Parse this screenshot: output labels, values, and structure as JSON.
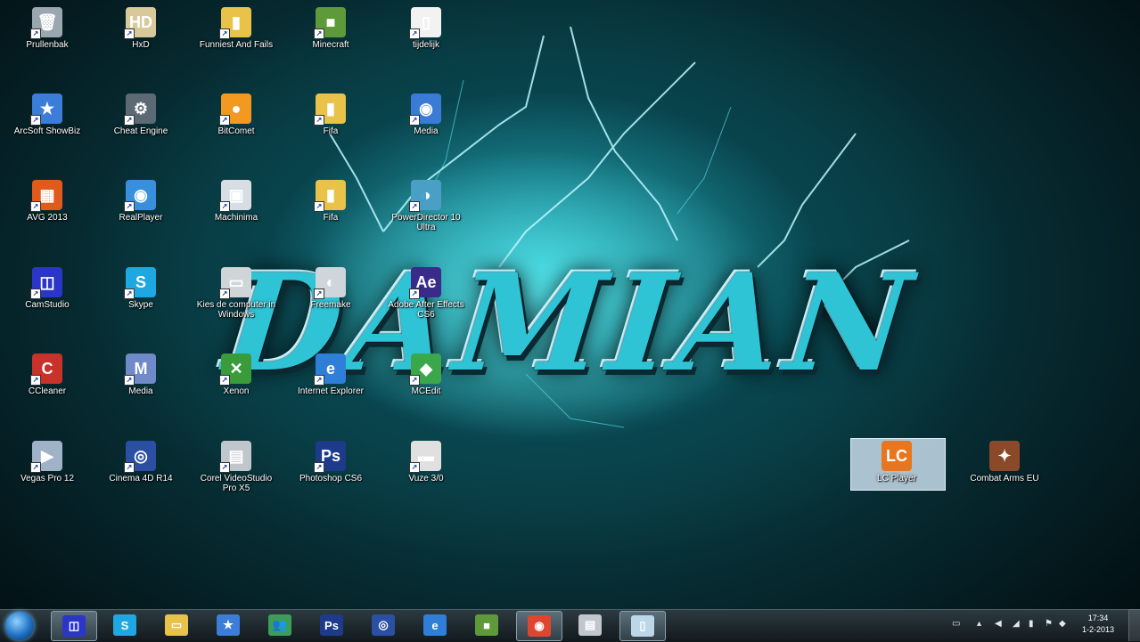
{
  "wallpaper": {
    "logo_text": "DAMIAN"
  },
  "desktop_icons": [
    {
      "name": "prullenbak-icon",
      "label": "Prullenbak",
      "glyph": "🗑",
      "color": "#9aa7b0"
    },
    {
      "name": "arcsoft-showbiz-icon",
      "label": "ArcSoft ShowBiz",
      "glyph": "★",
      "color": "#3b7dd8"
    },
    {
      "name": "avg-2013-icon",
      "label": "AVG 2013",
      "glyph": "▦",
      "color": "#e05a1c"
    },
    {
      "name": "camstudio-icon",
      "label": "CamStudio",
      "glyph": "◫",
      "color": "#2b36c9"
    },
    {
      "name": "ccleaner-icon",
      "label": "CCleaner",
      "glyph": "C",
      "color": "#c8322a"
    },
    {
      "name": "vegas-pro-icon",
      "label": "Vegas Pro 12",
      "glyph": "▶",
      "color": "#9fb2c7"
    },
    {
      "name": "hd-icon",
      "label": "HxD",
      "glyph": "HD",
      "color": "#d8c89a"
    },
    {
      "name": "cheat-engine-icon",
      "label": "Cheat Engine",
      "glyph": "⚙",
      "color": "#5b6a75"
    },
    {
      "name": "realplayer-icon",
      "label": "RealPlayer",
      "glyph": "◉",
      "color": "#3a8fdc"
    },
    {
      "name": "skype-icon",
      "label": "Skype",
      "glyph": "S",
      "color": "#1ea7e1"
    },
    {
      "name": "media-icon",
      "label": "Media",
      "glyph": "M",
      "color": "#6f89c9"
    },
    {
      "name": "cinema-4d-icon",
      "label": "Cinema 4D R14",
      "glyph": "◎",
      "color": "#2b4fa3"
    },
    {
      "name": "funniest-and-fails-icon",
      "label": "Funniest And Fails",
      "glyph": "▮",
      "color": "#e9c24a"
    },
    {
      "name": "bitcomet-icon",
      "label": "BitComet",
      "glyph": "●",
      "color": "#f29a1f"
    },
    {
      "name": "machinima-icon",
      "label": "Machinima",
      "glyph": "▣",
      "color": "#d7dde3"
    },
    {
      "name": "folder-drive-icon",
      "label": "Kies de computer in Windows",
      "glyph": "▭",
      "color": "#d0d5d8"
    },
    {
      "name": "xbox-icon",
      "label": "Xenon",
      "glyph": "✕",
      "color": "#3a9b3a"
    },
    {
      "name": "corel-videostudio-icon",
      "label": "Corel VideoStudio Pro X5",
      "glyph": "▤",
      "color": "#c0c6cc"
    },
    {
      "name": "minecraft-icon",
      "label": "Minecraft",
      "glyph": "■",
      "color": "#5e9a3a"
    },
    {
      "name": "folder-icon",
      "label": "Fifa",
      "glyph": "▮",
      "color": "#e9c24a"
    },
    {
      "name": "folder-2-icon",
      "label": "Fifa",
      "glyph": "▮",
      "color": "#e9c24a"
    },
    {
      "name": "fraps-icon",
      "label": "Freemake",
      "glyph": "◐",
      "color": "#cfd6db"
    },
    {
      "name": "internet-explorer-icon",
      "label": "Internet Explorer",
      "glyph": "e",
      "color": "#2f7ed8"
    },
    {
      "name": "photoshop-icon",
      "label": "Photoshop CS6",
      "glyph": "Ps",
      "color": "#1d3b8a"
    },
    {
      "name": "blank-file-icon",
      "label": "tijdelijk",
      "glyph": "▯",
      "color": "#f2f2f2"
    },
    {
      "name": "dvd-player-icon",
      "label": "Media",
      "glyph": "◉",
      "color": "#3a7bd5"
    },
    {
      "name": "powerdvd-icon",
      "label": "PowerDirector 10 Ultra",
      "glyph": "◑",
      "color": "#4a9fc7"
    },
    {
      "name": "after-effects-icon",
      "label": "Adobe After Effects CS6",
      "glyph": "Ae",
      "color": "#3a2a8a"
    },
    {
      "name": "mcedit-icon",
      "label": "MCEdit",
      "glyph": "◆",
      "color": "#3aa84a"
    },
    {
      "name": "small-icon",
      "label": "Vuze 3/0",
      "glyph": "▬",
      "color": "#e0e0e0"
    }
  ],
  "right_icons": [
    {
      "name": "lc-player-icon",
      "label": "LC Player",
      "glyph": "LC",
      "color": "#e8761e"
    },
    {
      "name": "combat-arms-icon",
      "label": "Combat Arms EU",
      "glyph": "✦",
      "color": "#8a4a2a"
    }
  ],
  "taskbar": {
    "items": [
      {
        "name": "taskbar-camstudio-icon",
        "glyph": "◫",
        "color": "#2b36c9",
        "active": true
      },
      {
        "name": "taskbar-skype-icon",
        "glyph": "S",
        "color": "#1ea7e1",
        "active": false
      },
      {
        "name": "taskbar-explorer-icon",
        "glyph": "▭",
        "color": "#e9c24a",
        "active": false
      },
      {
        "name": "taskbar-showbiz-icon",
        "glyph": "★",
        "color": "#3b7dd8",
        "active": false
      },
      {
        "name": "taskbar-messenger-icon",
        "glyph": "👥",
        "color": "#3c9d5b",
        "active": false
      },
      {
        "name": "taskbar-photoshop-icon",
        "glyph": "Ps",
        "color": "#1d3b8a",
        "active": false
      },
      {
        "name": "taskbar-cinema4d-icon",
        "glyph": "◎",
        "color": "#2b4fa3",
        "active": false
      },
      {
        "name": "taskbar-ie-icon",
        "glyph": "e",
        "color": "#2f7ed8",
        "active": false
      },
      {
        "name": "taskbar-minecraft-icon",
        "glyph": "■",
        "color": "#5e9a3a",
        "active": false
      },
      {
        "name": "taskbar-chrome-icon",
        "glyph": "◉",
        "color": "#e0452f",
        "active": true
      },
      {
        "name": "taskbar-corel-icon",
        "glyph": "▤",
        "color": "#c0c6cc",
        "active": false
      },
      {
        "name": "taskbar-generic-icon",
        "glyph": "▯",
        "color": "#bcd7e8",
        "active": true
      }
    ],
    "clock_time": "17:34",
    "clock_date": "1-2-2013"
  }
}
